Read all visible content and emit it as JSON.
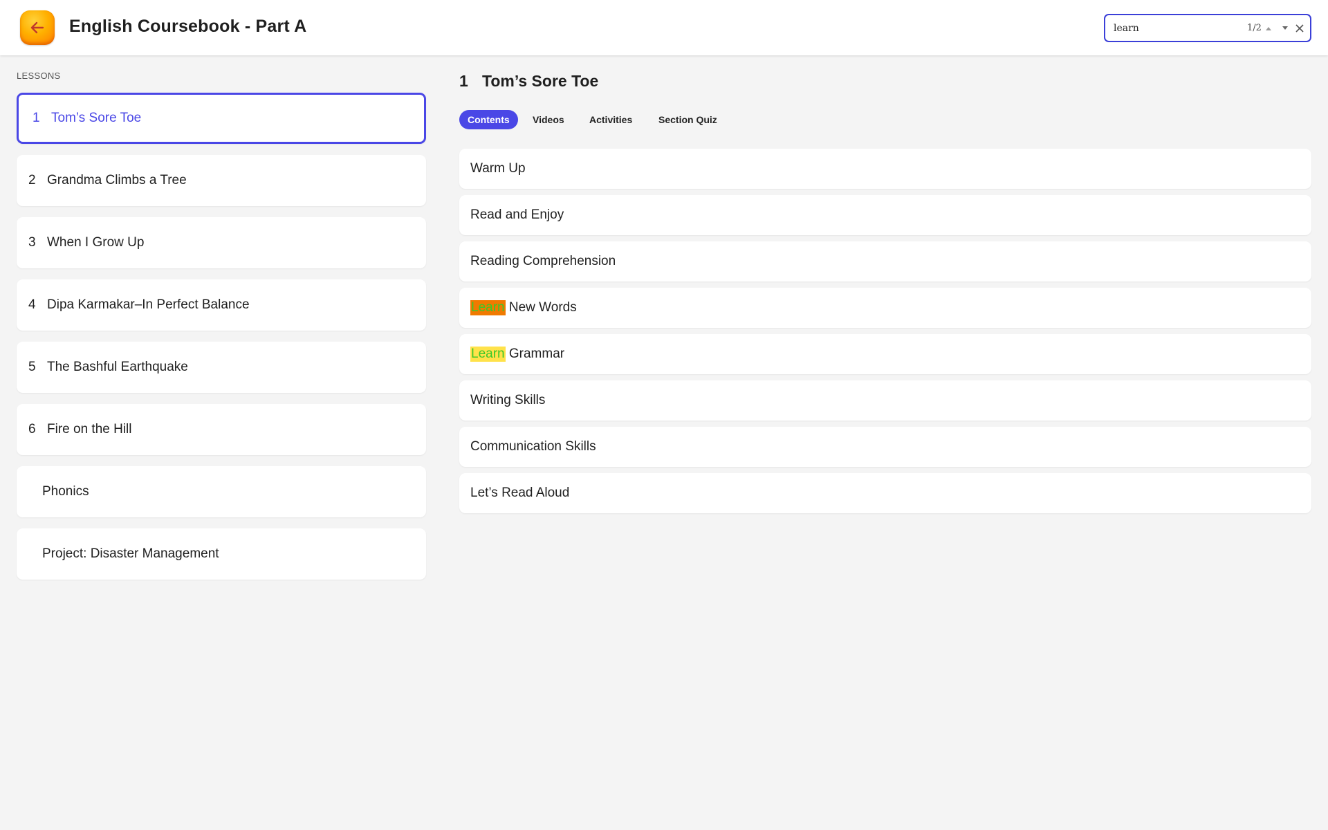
{
  "header": {
    "title": "English Coursebook - Part A",
    "back_icon": "arrow-left-icon"
  },
  "find": {
    "query": "learn",
    "count": "1/2"
  },
  "sidebar": {
    "label": "LESSONS",
    "items": [
      {
        "num": "1",
        "label": "Tom’s Sore Toe",
        "active": true
      },
      {
        "num": "2",
        "label": "Grandma Climbs a Tree"
      },
      {
        "num": "3",
        "label": "When I Grow Up"
      },
      {
        "num": "4",
        "label": "Dipa Karmakar–In Perfect Balance"
      },
      {
        "num": "5",
        "label": "The Bashful Earthquake"
      },
      {
        "num": "6",
        "label": "Fire on the Hill"
      },
      {
        "num": "",
        "label": "Phonics"
      },
      {
        "num": "",
        "label": "Project: Disaster Management"
      }
    ]
  },
  "main": {
    "num": "1",
    "title": "Tom’s Sore Toe",
    "tabs": [
      {
        "label": "Contents",
        "active": true
      },
      {
        "label": "Videos"
      },
      {
        "label": "Activities"
      },
      {
        "label": "Section Quiz"
      }
    ],
    "sections": [
      {
        "label": "Warm Up"
      },
      {
        "label": "Read and Enjoy"
      },
      {
        "label": "Reading Comprehension"
      },
      {
        "highlight": "Learn",
        "rest": " New Words",
        "current_match": true
      },
      {
        "highlight": "Learn",
        "rest": " Grammar"
      },
      {
        "label": "Writing Skills"
      },
      {
        "label": "Communication Skills"
      },
      {
        "label": "Let’s Read Aloud"
      }
    ]
  },
  "colors": {
    "accent": "#4a47e6",
    "back_button": "#ffb000",
    "highlight": "#ffe24a",
    "current_highlight": "#f07a00",
    "highlight_text": "#3cc82a"
  }
}
